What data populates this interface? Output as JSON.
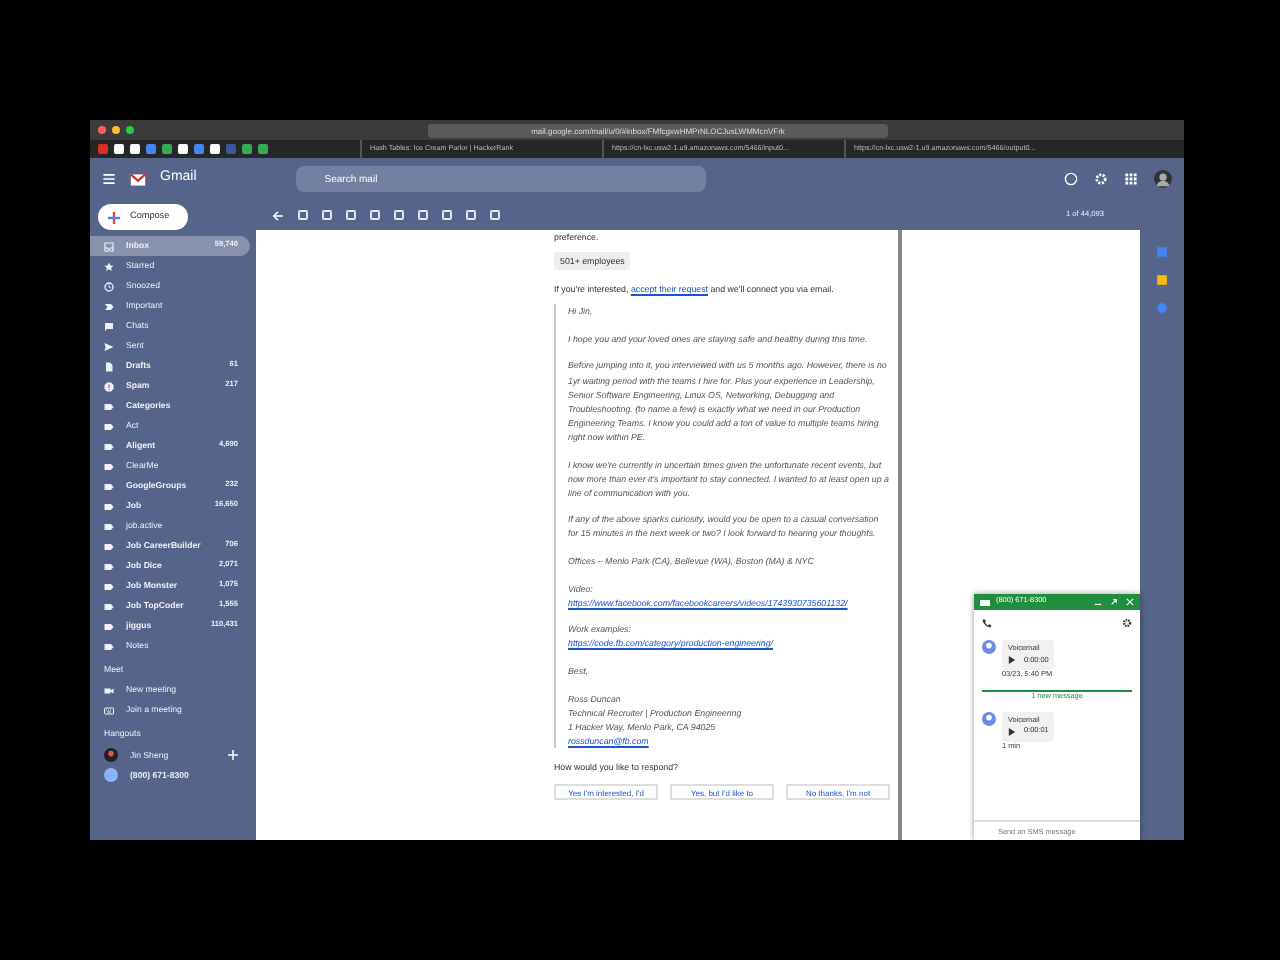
{
  "browser": {
    "url": "mail.google.com/mail/u/0/#inbox/FMfcgxwHMPrNLOCJusLWMMcnVFrk",
    "tabs": [
      {
        "title": "Hash Tables: Ice Cream Parlor | HackerRank"
      },
      {
        "title": "https://cn-lxc.usw2-1.u9.amazonaws.com/5466/input0..."
      },
      {
        "title": "https://cn-lxc.usw2-1.u9.amazonaws.com/5466/output0..."
      }
    ]
  },
  "gmail": {
    "logo": "Gmail",
    "search": {
      "placeholder": "Search mail"
    }
  },
  "toolbar": {
    "pager": "1 of 44,093"
  },
  "sidebar": {
    "compose": "Compose",
    "items": [
      {
        "label": "Inbox",
        "count": "59,740",
        "kind": "inbox",
        "bold": true,
        "selected": true
      },
      {
        "label": "Starred",
        "kind": "star",
        "bold": false,
        "selected": false
      },
      {
        "label": "Snoozed",
        "kind": "clock",
        "bold": false,
        "selected": false
      },
      {
        "label": "Important",
        "kind": "important",
        "bold": false,
        "selected": false
      },
      {
        "label": "Chats",
        "kind": "chat",
        "bold": false,
        "selected": false
      },
      {
        "label": "Sent",
        "kind": "sent",
        "bold": false,
        "selected": false
      },
      {
        "label": "Drafts",
        "count": "61",
        "kind": "draft",
        "bold": true,
        "selected": false
      },
      {
        "label": "Spam",
        "count": "217",
        "kind": "spam",
        "bold": true,
        "selected": false
      },
      {
        "label": "Categories",
        "kind": "label",
        "bold": true,
        "selected": false
      },
      {
        "label": "Act",
        "kind": "label",
        "bold": false,
        "selected": false
      },
      {
        "label": "Aligent",
        "count": "4,690",
        "kind": "label",
        "bold": true,
        "selected": false
      },
      {
        "label": "ClearMe",
        "kind": "label",
        "bold": false,
        "selected": false
      },
      {
        "label": "GoogleGroups",
        "count": "232",
        "kind": "label",
        "bold": true,
        "selected": false
      },
      {
        "label": "Job",
        "count": "16,650",
        "kind": "label",
        "bold": true,
        "selected": false
      },
      {
        "label": "job.active",
        "kind": "label",
        "bold": false,
        "selected": false
      },
      {
        "label": "Job CareerBuilder",
        "count": "706",
        "kind": "label",
        "bold": true,
        "selected": false
      },
      {
        "label": "Job Dice",
        "count": "2,071",
        "kind": "label",
        "bold": true,
        "selected": false
      },
      {
        "label": "Job Monster",
        "count": "1,075",
        "kind": "label",
        "bold": true,
        "selected": false
      },
      {
        "label": "Job TopCoder",
        "count": "1,555",
        "kind": "label",
        "bold": true,
        "selected": false
      },
      {
        "label": "jiggus",
        "count": "110,431",
        "kind": "label",
        "bold": true,
        "selected": false
      },
      {
        "label": "Notes",
        "kind": "label",
        "bold": false,
        "selected": false
      }
    ],
    "meet": {
      "heading": "Meet",
      "items": [
        {
          "label": "New meeting",
          "kind": "video"
        },
        {
          "label": "Join a meeting",
          "kind": "keyboard"
        }
      ]
    },
    "hangouts": {
      "heading": "Hangouts",
      "user": "Jin Sheng",
      "phone": "(800) 671-8300"
    }
  },
  "message": {
    "cut_line": "preference.",
    "tag": "501+ employees",
    "intro": {
      "before": "If you're interested,",
      "link": "accept their request",
      "after": "and we'll connect you via email."
    },
    "quote": [
      {
        "lines": [
          {
            "kind": "text",
            "text": "Hi Jin,"
          }
        ]
      },
      {
        "lines": [
          {
            "kind": "text",
            "text": "I hope you and your loved ones are staying safe and healthy during this time."
          }
        ]
      },
      {
        "lines": [
          {
            "kind": "text",
            "text": "Before jumping into it, you interviewed with us 5 months ago. However, there is no 1yr waiting period with the teams I hire for. Plus your experience in Leadership, Senior Software Engineering, Linux OS, Networking, Debugging and Troubleshooting. (to name a few) is exactly what we need in our Production Engineering Teams. I know you could add a ton of value to multiple teams hiring right now within PE."
          }
        ]
      },
      {
        "lines": [
          {
            "kind": "text",
            "text": "I know we're currently in uncertain times given the unfortunate recent events, but now more than ever it's important to stay connected. I wanted to at least open up a line of communication with you."
          }
        ]
      },
      {
        "lines": [
          {
            "kind": "text",
            "text": "If any of the above sparks curiosity, would you be open to a casual conversation for 15 minutes in the next week or two? I look forward to hearing your thoughts."
          }
        ]
      },
      {
        "lines": [
          {
            "kind": "text",
            "text": "Offices – Menlo Park (CA), Bellevue (WA), Boston (MA) & NYC"
          }
        ]
      },
      {
        "lines": [
          {
            "kind": "text",
            "text": "Video:"
          },
          {
            "kind": "link",
            "text": "https://www.facebook.com/facebookcareers/videos/1743930735601132/"
          }
        ]
      },
      {
        "lines": [
          {
            "kind": "text",
            "text": "Work examples:"
          },
          {
            "kind": "link",
            "text": "https://code.fb.com/category/production-engineering/"
          }
        ]
      },
      {
        "lines": [
          {
            "kind": "text",
            "text": "Best,"
          }
        ]
      },
      {
        "lines": [
          {
            "kind": "text",
            "text": "Ross Duncan"
          },
          {
            "kind": "text",
            "text": "Technical Recruiter | Production Engineering"
          },
          {
            "kind": "text",
            "text": "1 Hacker Way, Menlo Park, CA 94025"
          },
          {
            "kind": "link",
            "text": "rossduncan@fb.com"
          }
        ]
      }
    ],
    "question": "How would you like to respond?",
    "responses": [
      "Yes I'm interested, I'd",
      "Yes, but I'd like to",
      "No thanks, I'm not"
    ]
  },
  "chat": {
    "title": "(800) 671-8300",
    "divider": "1 new message",
    "placeholder": "Send an SMS message",
    "messages": [
      {
        "label": "Voicemail",
        "duration": "0:00:00",
        "time": "03/23, 5:40 PM"
      },
      {
        "label": "Voicemail",
        "duration": "0:00:01",
        "time": "1 min"
      }
    ]
  }
}
